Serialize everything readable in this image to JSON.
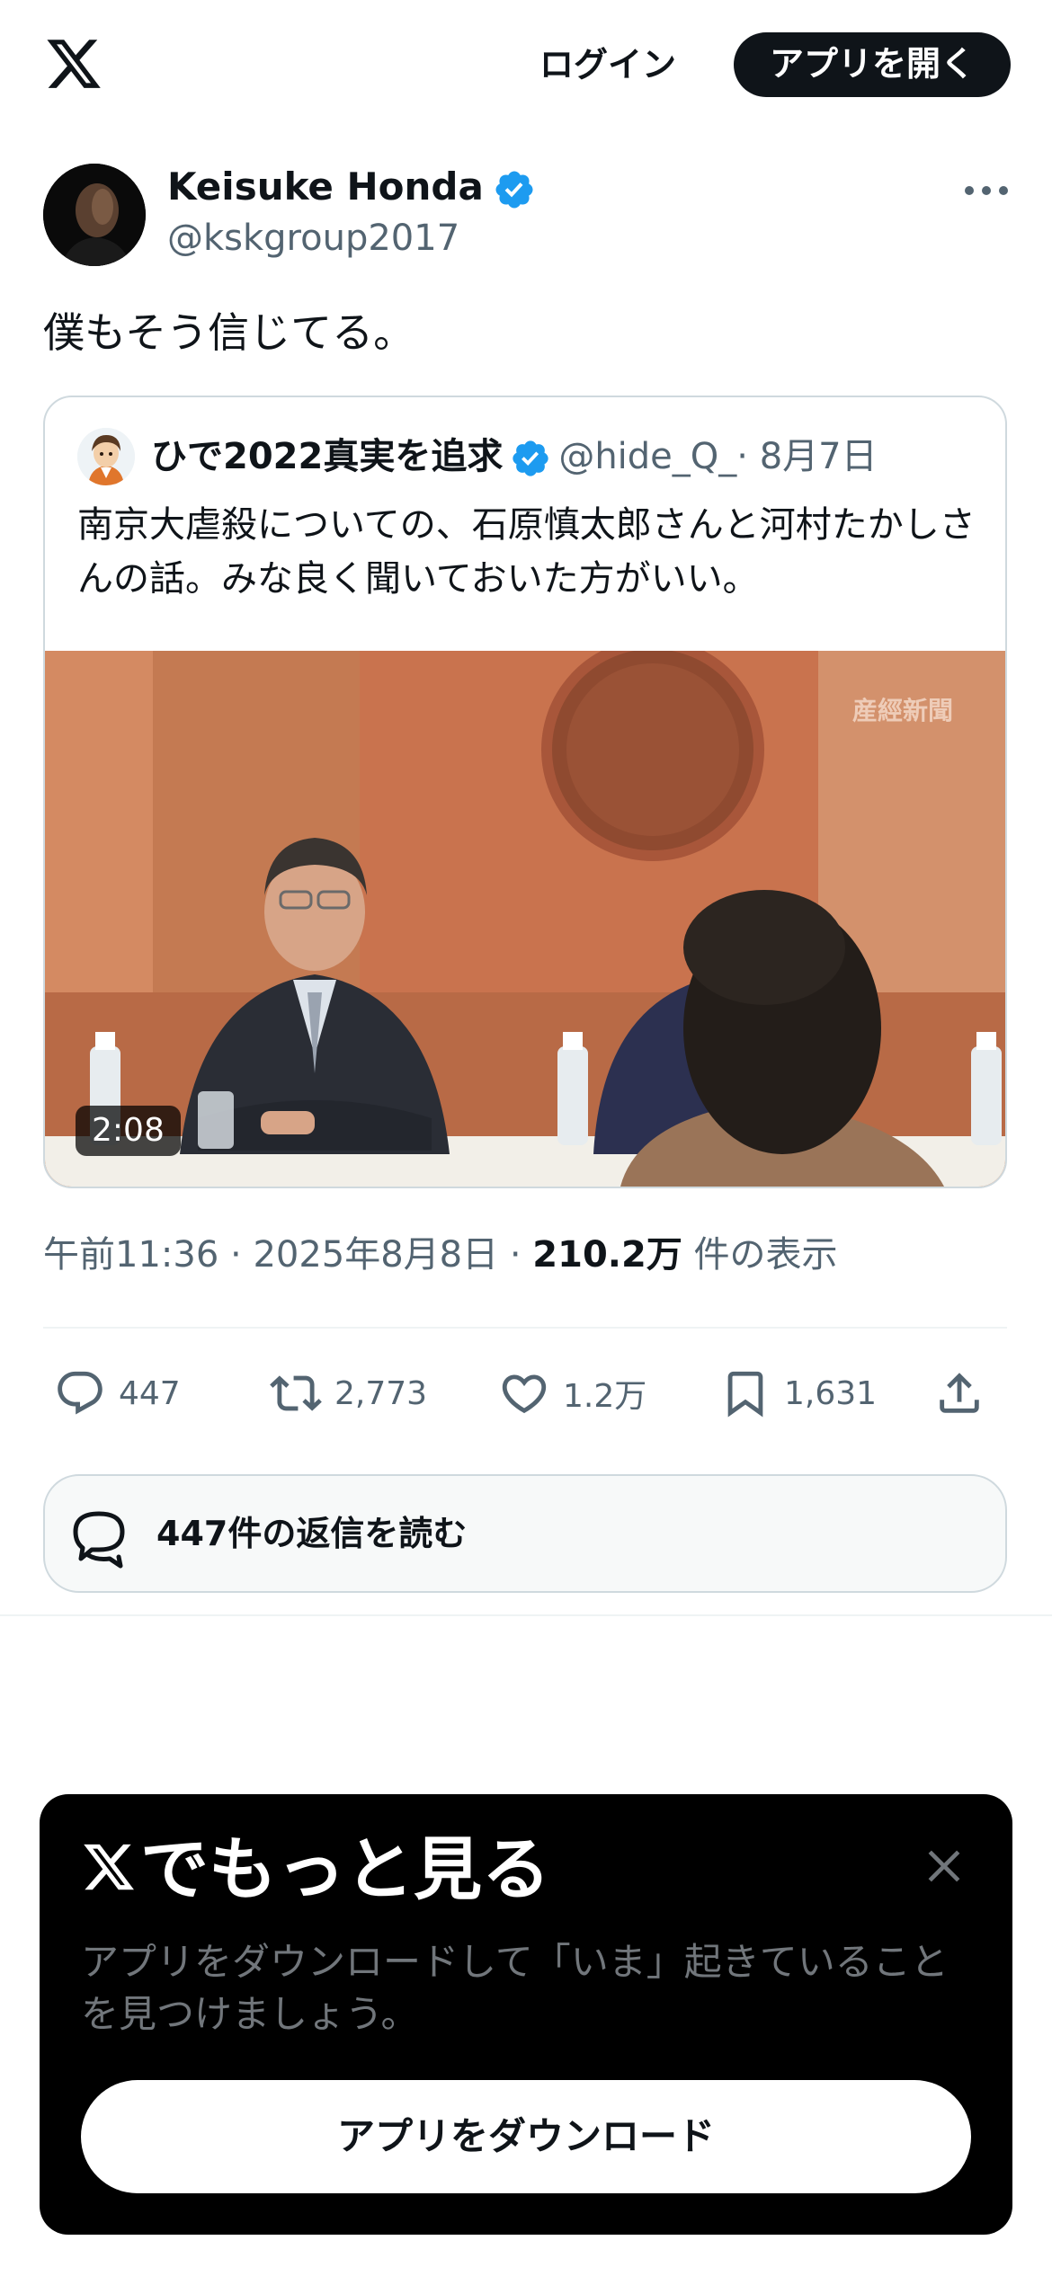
{
  "header": {
    "logo_icon": "x-logo-icon",
    "login_label": "ログイン",
    "open_app_label": "アプリを開く"
  },
  "post": {
    "author": {
      "display_name": "Keisuke Honda",
      "handle": "@kskgroup2017",
      "verified": true
    },
    "text": "僕もそう信じてる。",
    "quoted": {
      "display_name": "ひで2022真実を追求",
      "handle": "@hide_Q_",
      "date": "· 8月7日",
      "verified": true,
      "text": "南京大虐殺についての、石原慎太郎さんと河村たかしさんの話。みな良く聞いておいた方がいい。",
      "video": {
        "duration": "2:08",
        "watermark": "産經新聞"
      }
    },
    "meta": {
      "time": "午前11:36",
      "date": "2025年8月8日",
      "views_count": "210.2万",
      "views_label": "件の表示"
    },
    "actions": {
      "replies": "447",
      "reposts": "2,773",
      "likes": "1.2万",
      "bookmarks": "1,631"
    },
    "read_replies_label": "447件の返信を読む"
  },
  "promo": {
    "title": "でもっと見る",
    "body": "アプリをダウンロードして「いま」起きていることを見つけましょう。",
    "download_label": "アプリをダウンロード"
  },
  "colors": {
    "verified_blue": "#1d9bf0",
    "text_primary": "#0f1419",
    "text_secondary": "#536471",
    "border": "#cfd9de"
  }
}
